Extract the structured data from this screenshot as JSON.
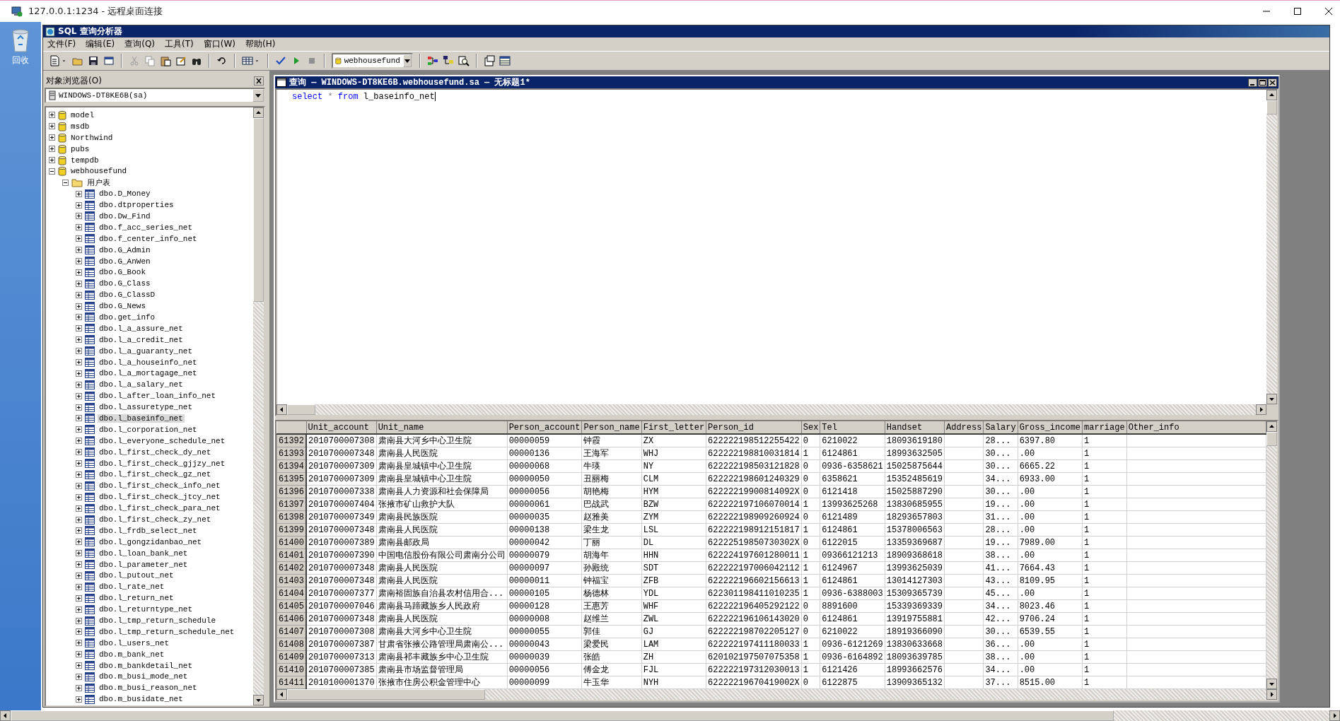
{
  "remote_window": {
    "title": "127.0.0.1:1234 - 远程桌面连接"
  },
  "desktop": {
    "icons": [
      {
        "label": "回收"
      }
    ]
  },
  "app": {
    "title": "SQL 查询分析器",
    "menu": [
      "文件(F)",
      "编辑(E)",
      "查询(Q)",
      "工具(T)",
      "窗口(W)",
      "帮助(H)"
    ],
    "database": "webhousefund"
  },
  "object_browser": {
    "title": "对象浏览器(O)",
    "server": "WINDOWS-DT8KE6B(sa)",
    "tree": [
      {
        "label": "model",
        "kind": "database",
        "expanded": false,
        "selected": false
      },
      {
        "label": "msdb",
        "kind": "database",
        "expanded": false,
        "selected": false
      },
      {
        "label": "Northwind",
        "kind": "database",
        "expanded": false,
        "selected": false
      },
      {
        "label": "pubs",
        "kind": "database",
        "expanded": false,
        "selected": false
      },
      {
        "label": "tempdb",
        "kind": "database",
        "expanded": false,
        "selected": false
      },
      {
        "label": "webhousefund",
        "kind": "database",
        "expanded": true,
        "selected": false,
        "children": [
          {
            "label": "用户表",
            "kind": "folder",
            "expanded": true,
            "selected": false,
            "children": [
              {
                "label": "dbo.D_Money",
                "kind": "table",
                "expanded": false,
                "selected": false
              },
              {
                "label": "dbo.dtproperties",
                "kind": "table",
                "expanded": false,
                "selected": false
              },
              {
                "label": "dbo.Dw_Find",
                "kind": "table",
                "expanded": false,
                "selected": false
              },
              {
                "label": "dbo.f_acc_series_net",
                "kind": "table",
                "expanded": false,
                "selected": false
              },
              {
                "label": "dbo.f_center_info_net",
                "kind": "table",
                "expanded": false,
                "selected": false
              },
              {
                "label": "dbo.G_Admin",
                "kind": "table",
                "expanded": false,
                "selected": false
              },
              {
                "label": "dbo.G_AnWen",
                "kind": "table",
                "expanded": false,
                "selected": false
              },
              {
                "label": "dbo.G_Book",
                "kind": "table",
                "expanded": false,
                "selected": false
              },
              {
                "label": "dbo.G_Class",
                "kind": "table",
                "expanded": false,
                "selected": false
              },
              {
                "label": "dbo.G_ClassD",
                "kind": "table",
                "expanded": false,
                "selected": false
              },
              {
                "label": "dbo.G_News",
                "kind": "table",
                "expanded": false,
                "selected": false
              },
              {
                "label": "dbo.get_info",
                "kind": "table",
                "expanded": false,
                "selected": false
              },
              {
                "label": "dbo.l_a_assure_net",
                "kind": "table",
                "expanded": false,
                "selected": false
              },
              {
                "label": "dbo.l_a_credit_net",
                "kind": "table",
                "expanded": false,
                "selected": false
              },
              {
                "label": "dbo.l_a_guaranty_net",
                "kind": "table",
                "expanded": false,
                "selected": false
              },
              {
                "label": "dbo.l_a_houseinfo_net",
                "kind": "table",
                "expanded": false,
                "selected": false
              },
              {
                "label": "dbo.l_a_mortagage_net",
                "kind": "table",
                "expanded": false,
                "selected": false
              },
              {
                "label": "dbo.l_a_salary_net",
                "kind": "table",
                "expanded": false,
                "selected": false
              },
              {
                "label": "dbo.l_after_loan_info_net",
                "kind": "table",
                "expanded": false,
                "selected": false
              },
              {
                "label": "dbo.l_assuretype_net",
                "kind": "table",
                "expanded": false,
                "selected": false
              },
              {
                "label": "dbo.l_baseinfo_net",
                "kind": "table",
                "expanded": false,
                "selected": true
              },
              {
                "label": "dbo.l_corporation_net",
                "kind": "table",
                "expanded": false,
                "selected": false
              },
              {
                "label": "dbo.l_everyone_schedule_net",
                "kind": "table",
                "expanded": false,
                "selected": false
              },
              {
                "label": "dbo.l_first_check_dy_net",
                "kind": "table",
                "expanded": false,
                "selected": false
              },
              {
                "label": "dbo.l_first_check_gjjzy_net",
                "kind": "table",
                "expanded": false,
                "selected": false
              },
              {
                "label": "dbo.l_first_check_gz_net",
                "kind": "table",
                "expanded": false,
                "selected": false
              },
              {
                "label": "dbo.l_first_check_info_net",
                "kind": "table",
                "expanded": false,
                "selected": false
              },
              {
                "label": "dbo.l_first_check_jtcy_net",
                "kind": "table",
                "expanded": false,
                "selected": false
              },
              {
                "label": "dbo.l_first_check_para_net",
                "kind": "table",
                "expanded": false,
                "selected": false
              },
              {
                "label": "dbo.l_first_check_zy_net",
                "kind": "table",
                "expanded": false,
                "selected": false
              },
              {
                "label": "dbo.l_frdb_select_net",
                "kind": "table",
                "expanded": false,
                "selected": false
              },
              {
                "label": "dbo.l_gongzidanbao_net",
                "kind": "table",
                "expanded": false,
                "selected": false
              },
              {
                "label": "dbo.l_loan_bank_net",
                "kind": "table",
                "expanded": false,
                "selected": false
              },
              {
                "label": "dbo.l_parameter_net",
                "kind": "table",
                "expanded": false,
                "selected": false
              },
              {
                "label": "dbo.l_putout_net",
                "kind": "table",
                "expanded": false,
                "selected": false
              },
              {
                "label": "dbo.l_rate_net",
                "kind": "table",
                "expanded": false,
                "selected": false
              },
              {
                "label": "dbo.l_return_net",
                "kind": "table",
                "expanded": false,
                "selected": false
              },
              {
                "label": "dbo.l_returntype_net",
                "kind": "table",
                "expanded": false,
                "selected": false
              },
              {
                "label": "dbo.l_tmp_return_schedule",
                "kind": "table",
                "expanded": false,
                "selected": false
              },
              {
                "label": "dbo.l_tmp_return_schedule_net",
                "kind": "table",
                "expanded": false,
                "selected": false
              },
              {
                "label": "dbo.l_users_net",
                "kind": "table",
                "expanded": false,
                "selected": false
              },
              {
                "label": "dbo.m_bank_net",
                "kind": "table",
                "expanded": false,
                "selected": false
              },
              {
                "label": "dbo.m_bankdetail_net",
                "kind": "table",
                "expanded": false,
                "selected": false
              },
              {
                "label": "dbo.m_busi_mode_net",
                "kind": "table",
                "expanded": false,
                "selected": false
              },
              {
                "label": "dbo.m_busi_reason_net",
                "kind": "table",
                "expanded": false,
                "selected": false
              },
              {
                "label": "dbo.m_busidate_net",
                "kind": "table",
                "expanded": false,
                "selected": false
              }
            ]
          }
        ]
      }
    ]
  },
  "query_window": {
    "title": "查询 — WINDOWS-DT8KE6B.webhousefund.sa — 无标题1*",
    "sql": [
      {
        "text": "select",
        "kind": "keyword"
      },
      {
        "text": "*",
        "kind": "operator"
      },
      {
        "text": "from",
        "kind": "keyword"
      },
      {
        "text": "l_baseinfo_net",
        "kind": "identifier"
      }
    ],
    "results": {
      "columns": [
        "Unit_account",
        "Unit_name",
        "Person_account",
        "Person_name",
        "First_letter",
        "Person_id",
        "Sex",
        "Tel",
        "Handset",
        "Address",
        "Salary",
        "Gross_income",
        "marriage",
        "Other_info"
      ],
      "rows": [
        {
          "row_number": "61392",
          "cells": [
            "2010700007308",
            "肃南县大河乡中心卫生院",
            "00000059",
            "钟霞",
            "ZX",
            "622222198512255422",
            "0",
            "6210022",
            "18093619180",
            null,
            "28...",
            "6397.80",
            "1",
            null
          ]
        },
        {
          "row_number": "61393",
          "cells": [
            "2010700007348",
            "肃南县人民医院",
            "00000136",
            "王海军",
            "WHJ",
            "622222198810031814",
            "1",
            "6124861",
            "18993632505",
            null,
            "30...",
            ".00",
            "1",
            null
          ]
        },
        {
          "row_number": "61394",
          "cells": [
            "2010700007309",
            "肃南县皇城镇中心卫生院",
            "00000068",
            "牛瑛",
            "NY",
            "622222198503121828",
            "0",
            "0936-6358621",
            "15025875644",
            null,
            "30...",
            "6665.22",
            "1",
            null
          ]
        },
        {
          "row_number": "61395",
          "cells": [
            "2010700007309",
            "肃南县皇城镇中心卫生院",
            "00000050",
            "丑丽梅",
            "CLM",
            "622222198601240329",
            "0",
            "6358621",
            "15352485619",
            null,
            "34...",
            "6933.00",
            "1",
            null
          ]
        },
        {
          "row_number": "61396",
          "cells": [
            "2010700007338",
            "肃南县人力资源和社会保障局",
            "00000056",
            "胡艳梅",
            "HYM",
            "62222219900814092X",
            "0",
            "6121418",
            "15025887290",
            null,
            "30...",
            ".00",
            "1",
            null
          ]
        },
        {
          "row_number": "61397",
          "cells": [
            "2010700007404",
            "张掖市矿山救护大队",
            "00000061",
            "巴战武",
            "BZW",
            "622222197106070014",
            "1",
            "13993625268",
            "13830685955",
            null,
            "19...",
            ".00",
            "1",
            null
          ]
        },
        {
          "row_number": "61398",
          "cells": [
            "2010700007349",
            "肃南县民族医院",
            "00000035",
            "赵雅美",
            "ZYM",
            "622222198909260924",
            "0",
            "6121489",
            "18293657803",
            null,
            "31...",
            ".00",
            "1",
            null
          ]
        },
        {
          "row_number": "61399",
          "cells": [
            "2010700007348",
            "肃南县人民医院",
            "00000138",
            "梁生龙",
            "LSL",
            "622222198912151817",
            "1",
            "6124861",
            "15378006563",
            null,
            "28...",
            ".00",
            "1",
            null
          ]
        },
        {
          "row_number": "61400",
          "cells": [
            "2010700007389",
            "肃南县邮政局",
            "00000042",
            "丁丽",
            "DL",
            "62222519850730302X",
            "0",
            "6122015",
            "13359369687",
            null,
            "19...",
            "7989.00",
            "1",
            null
          ]
        },
        {
          "row_number": "61401",
          "cells": [
            "2010700007390",
            "中国电信股份有限公司肃南分公司",
            "00000079",
            "胡海年",
            "HHN",
            "622224197601280011",
            "1",
            "09366121213",
            "18909368618",
            null,
            "38...",
            ".00",
            "1",
            null
          ]
        },
        {
          "row_number": "61402",
          "cells": [
            "2010700007348",
            "肃南县人民医院",
            "00000097",
            "孙殿统",
            "SDT",
            "622222197006042112",
            "1",
            "6124967",
            "13993625039",
            null,
            "41...",
            "7664.43",
            "1",
            null
          ]
        },
        {
          "row_number": "61403",
          "cells": [
            "2010700007348",
            "肃南县人民医院",
            "00000011",
            "钟福宝",
            "ZFB",
            "622222196602156613",
            "1",
            "6124861",
            "13014127303",
            null,
            "43...",
            "8109.95",
            "1",
            null
          ]
        },
        {
          "row_number": "61404",
          "cells": [
            "2010700007377",
            "肃南裕固族自治县农村信用合...",
            "00000105",
            "杨德林",
            "YDL",
            "622301198411010235",
            "1",
            "0936-6388003",
            "15309365739",
            null,
            "45...",
            ".00",
            "1",
            null
          ]
        },
        {
          "row_number": "61405",
          "cells": [
            "2010700007046",
            "肃南县马蹄藏族乡人民政府",
            "00000128",
            "王惠芳",
            "WHF",
            "622222196405292122",
            "0",
            "8891600",
            "15339369339",
            null,
            "34...",
            "8023.46",
            "1",
            null
          ]
        },
        {
          "row_number": "61406",
          "cells": [
            "2010700007348",
            "肃南县人民医院",
            "00000008",
            "赵维兰",
            "ZWL",
            "622222196106143020",
            "0",
            "6124861",
            "13919755881",
            null,
            "42...",
            "9706.24",
            "1",
            null
          ]
        },
        {
          "row_number": "61407",
          "cells": [
            "2010700007308",
            "肃南县大河乡中心卫生院",
            "00000055",
            "郭佳",
            "GJ",
            "622222198702205127",
            "0",
            "6210022",
            "18919366090",
            null,
            "30...",
            "6539.55",
            "1",
            null
          ]
        },
        {
          "row_number": "61408",
          "cells": [
            "2010700007387",
            "甘肃省张掖公路管理局肃南公...",
            "00000043",
            "梁爱民",
            "LAM",
            "622222197411180033",
            "1",
            "0936-6121269",
            "13830633668",
            null,
            "36...",
            ".00",
            "1",
            null
          ]
        },
        {
          "row_number": "61409",
          "cells": [
            "2010700007313",
            "肃南县祁丰藏族乡中心卫生院",
            "00000039",
            "张皓",
            "ZH",
            "620102197507075358",
            "1",
            "0936-6164892",
            "18093639785",
            null,
            "38...",
            ".00",
            "1",
            null
          ]
        },
        {
          "row_number": "61410",
          "cells": [
            "2010700007385",
            "肃南县市场监督管理局",
            "00000056",
            "傅金龙",
            "FJL",
            "622222197312030013",
            "1",
            "6121426",
            "18993662576",
            null,
            "34...",
            ".00",
            "1",
            null
          ]
        },
        {
          "row_number": "61411",
          "cells": [
            "2010100001370",
            "张掖市住房公积金管理中心",
            "00000099",
            "牛玉华",
            "NYH",
            "62222219670419002X",
            "0",
            "6122875",
            "13909365132",
            null,
            "37...",
            "8515.00",
            "1",
            null
          ]
        }
      ]
    }
  }
}
